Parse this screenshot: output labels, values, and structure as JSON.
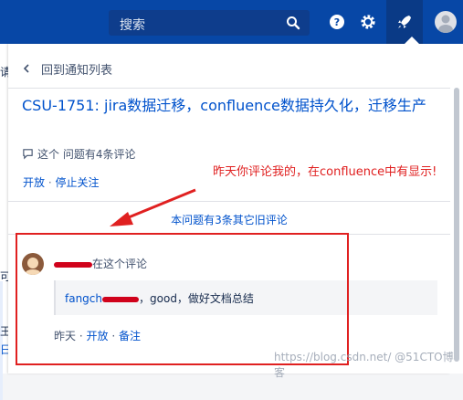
{
  "topbar": {
    "search_placeholder": "搜索",
    "icons": [
      "search-icon",
      "help-icon",
      "gear-icon",
      "notification-rocket-icon",
      "user-avatar-icon"
    ],
    "colors": {
      "bar": "#0747a6",
      "search_bg": "#0e3d8c"
    }
  },
  "left_edge": {
    "chars": [
      "请",
      "可",
      "王",
      "日"
    ]
  },
  "panel": {
    "back_label": "回到通知列表",
    "issue_title": "CSU-1751: jira数据迁移，confluence数据持久化，迁移生产",
    "comment_count": "这个 问题有4条评论",
    "actions": {
      "open": "开放",
      "separator": "·",
      "stop_watch": "停止关注"
    },
    "older_comments": "本问题有3条其它旧评论",
    "comment": {
      "header_suffix": "在这个评论",
      "quote_mention": "fangch",
      "quote_text": "，good，做好文档总结",
      "time": "昨天",
      "open": "开放",
      "note": "备注"
    }
  },
  "annotation": {
    "text": "昨天你评论我的，在confluence中有显示!",
    "color": "#e02020"
  },
  "watermark": "https://blog.csdn.net/ @51CTO博客"
}
